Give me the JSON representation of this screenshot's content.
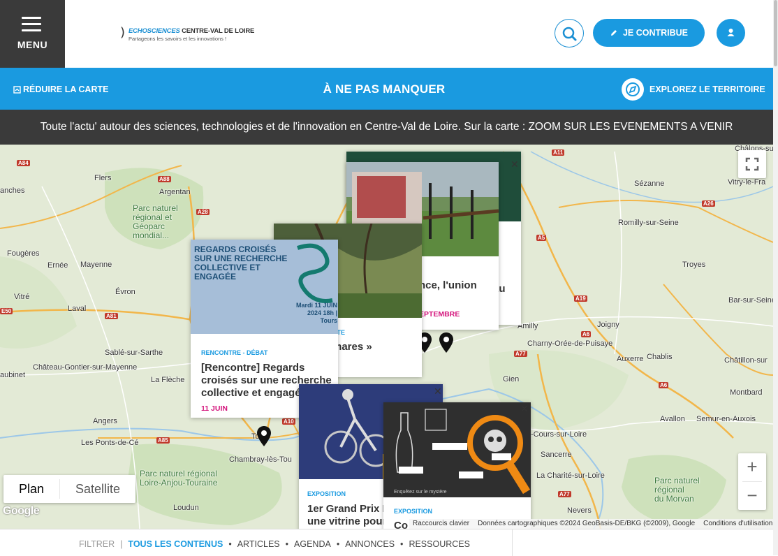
{
  "header": {
    "menu_label": "MENU",
    "logo_line1_echo": "ECHOSCIENCES",
    "logo_line1_rest": " CENTRE-VAL DE LOIRE",
    "logo_tagline": "Partageons les savoirs et les innovations !",
    "contribute_label": "JE CONTRIBUE"
  },
  "bluebar": {
    "reduce_label": "RÉDUIRE LA CARTE",
    "title": "À NE PAS MANQUER",
    "explore_label": "EXPLOREZ LE TERRITOIRE"
  },
  "intro": "Toute l'actu' autour des sciences, technologies et de l'innovation en Centre-Val de Loire. Sur la carte : ZOOM SUR LES EVENEMENTS A VENIR",
  "map": {
    "labels": {
      "flers": "Flers",
      "argentan": "Argentan",
      "fougeres": "Fougères",
      "ernee": "Ernée",
      "mayenne": "Mayenne",
      "evron": "Évron",
      "vitre": "Vitré",
      "laval": "Laval",
      "sable": "Sablé-sur-Sarthe",
      "chateau_gontier": "Château-Gontier-sur-Mayenne",
      "la_fleche": "La Flèche",
      "angers": "Angers",
      "ponts_de_ce": "Les Ponts-de-Cé",
      "chambray": "Chambray-lès-Tou",
      "loudun": "Loudun",
      "tours": "Tours",
      "sezanne": "Sézanne",
      "vitry": "Vitry-le-Fra",
      "romilly": "Romilly-sur-Seine",
      "troyes": "Troyes",
      "bar_sur_seine": "Bar-sur-Seine",
      "amilly": "Amilly",
      "joigny": "Joigny",
      "charny": "Charny-Orée-de-Puisaye",
      "auxerre": "Auxerre",
      "chablis": "Chablis",
      "chatillon": "Châtillon-sur",
      "gien": "Gien",
      "montbard": "Montbard",
      "avallon": "Avallon",
      "semur": "Semur-en-Auxois",
      "cours_sur_loire": "-Cours-sur-Loire",
      "sancerre": "Sancerre",
      "charite": "La Charité-sur-Loire",
      "nevers": "Nevers",
      "chalons": "Châlons-sur",
      "ranches": "anches",
      "aubinet": "aubinet"
    },
    "parks": {
      "normandie_maine": "Parc naturel\nrégional et\nGéoparc\nmondial...",
      "loire_anjou": "Parc naturel régional\nLoire-Anjou-Touraine",
      "morvan": "Parc naturel\nrégional\ndu Morvan"
    },
    "roads": [
      "A84",
      "A88",
      "A28",
      "A81",
      "E50",
      "A11",
      "A10",
      "A85",
      "A5",
      "A26",
      "A19",
      "A6",
      "A77",
      "A6",
      "A77"
    ],
    "maptype_plan": "Plan",
    "maptype_satellite": "Satellite",
    "google": "Google",
    "attrib_shortcuts": "Raccourcis clavier",
    "attrib_data": "Données cartographiques ©2024 GeoBasis-DE/BKG (©2009), Google",
    "attrib_terms": "Conditions d'utilisation"
  },
  "cards": [
    {
      "category": "RENCONTRE - DÉBAT",
      "title": "[Rencontre] Regards croisés sur une recherche collective et engagée",
      "date": "11 JUIN",
      "image_title": "REGARDS CROISÉS SUR UNE RECHERCHE COLLECTIVE ET ENGAGÉE",
      "image_date": "Mardi 11 JUIN 2024 18h | Tours"
    },
    {
      "category": "RTE",
      "title": "mares »",
      "date": ""
    },
    {
      "category": "",
      "title": "nce, l'union",
      "date": "EPTEMBRE"
    },
    {
      "category": "",
      "title": "au",
      "date": ""
    },
    {
      "category": "EXPOSITION",
      "title": "1er Grand Prix N une vitrine pour",
      "date": ""
    },
    {
      "category": "EXPOSITION",
      "title": "Co",
      "date": "",
      "image_caption": "Enquêtez sur le mystère"
    }
  ],
  "filterbar": {
    "label": "FILTRER",
    "items": [
      "TOUS LES CONTENUS",
      "ARTICLES",
      "AGENDA",
      "ANNONCES",
      "RESSOURCES"
    ]
  },
  "colors": {
    "accent": "#1a9ae0",
    "dark": "#3a3a3a",
    "date": "#d4147c"
  }
}
